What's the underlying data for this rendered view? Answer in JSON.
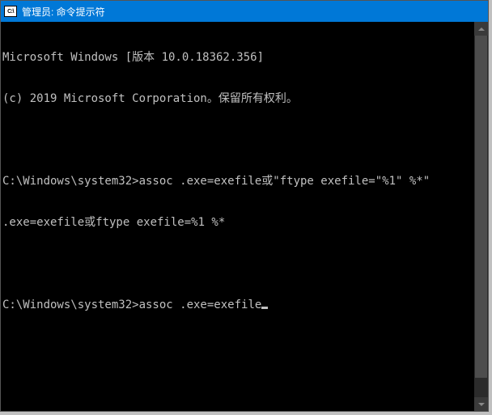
{
  "titlebar": {
    "icon_text": "C:\\",
    "title": "管理员: 命令提示符"
  },
  "terminal": {
    "lines": [
      "Microsoft Windows [版本 10.0.18362.356]",
      "(c) 2019 Microsoft Corporation。保留所有权利。",
      "",
      "C:\\Windows\\system32>assoc .exe=exefile或\"ftype exefile=\"%1\" %*\"",
      ".exe=exefile或ftype exefile=%1 %*",
      "",
      "C:\\Windows\\system32>assoc .exe=exefile"
    ],
    "current_prompt": "C:\\Windows\\system32>",
    "current_input": "assoc .exe=exefile"
  }
}
